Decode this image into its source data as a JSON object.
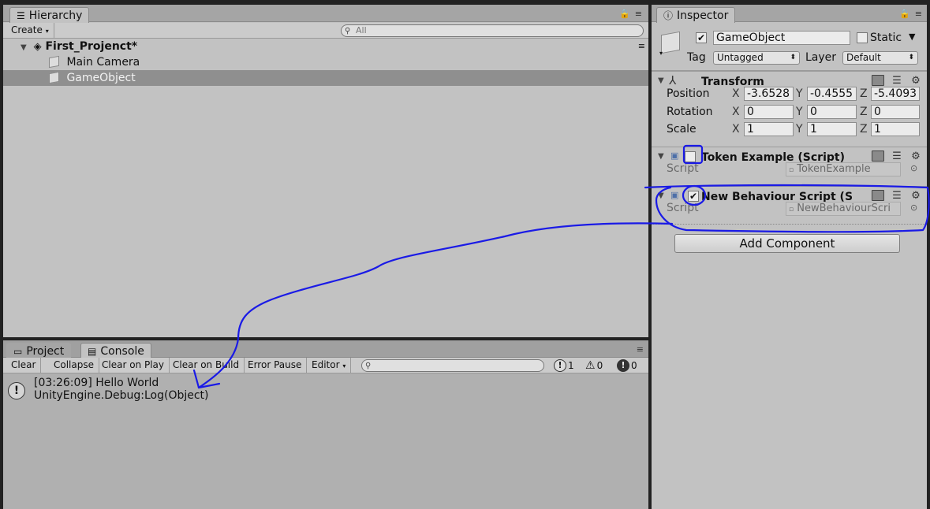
{
  "hierarchy": {
    "tab_label": "Hierarchy",
    "create_label": "Create",
    "search_placeholder": "All",
    "scene_name": "First_Projenct*",
    "items": [
      "Main Camera",
      "GameObject"
    ]
  },
  "inspector": {
    "tab_label": "Inspector",
    "object_name": "GameObject",
    "active": true,
    "static_label": "Static",
    "tag_label": "Tag",
    "tag_value": "Untagged",
    "layer_label": "Layer",
    "layer_value": "Default",
    "transform": {
      "title": "Transform",
      "position_label": "Position",
      "rotation_label": "Rotation",
      "scale_label": "Scale",
      "axis_x": "X",
      "axis_y": "Y",
      "axis_z": "Z",
      "position": [
        "-3.6528",
        "-0.4555",
        "-5.4093"
      ],
      "rotation": [
        "0",
        "0",
        "0"
      ],
      "scale": [
        "1",
        "1",
        "1"
      ]
    },
    "token_example": {
      "title": "Token Example (Script)",
      "enabled": false,
      "script_label": "Script",
      "script_value": "TokenExample"
    },
    "new_behaviour": {
      "title": "New Behaviour Script (S",
      "enabled": true,
      "script_label": "Script",
      "script_value": "NewBehaviourScri"
    },
    "add_component_label": "Add Component"
  },
  "bottom_tabs": {
    "project_label": "Project",
    "console_label": "Console"
  },
  "console": {
    "toolbar": {
      "clear": "Clear",
      "collapse": "Collapse",
      "clear_on_play": "Clear on Play",
      "clear_on_build": "Clear on Build",
      "error_pause": "Error Pause",
      "editor": "Editor"
    },
    "counts": {
      "log": "1",
      "warning": "0",
      "error": "0"
    },
    "entries": [
      {
        "line1": "[03:26:09] Hello World",
        "line2": "UnityEngine.Debug:Log(Object)"
      }
    ]
  },
  "colors": {
    "panel_bg": "#c2c2c2",
    "frame_bg": "#222222",
    "annotation": "#1a1ae6",
    "selected_row": "#8f8f8f"
  }
}
